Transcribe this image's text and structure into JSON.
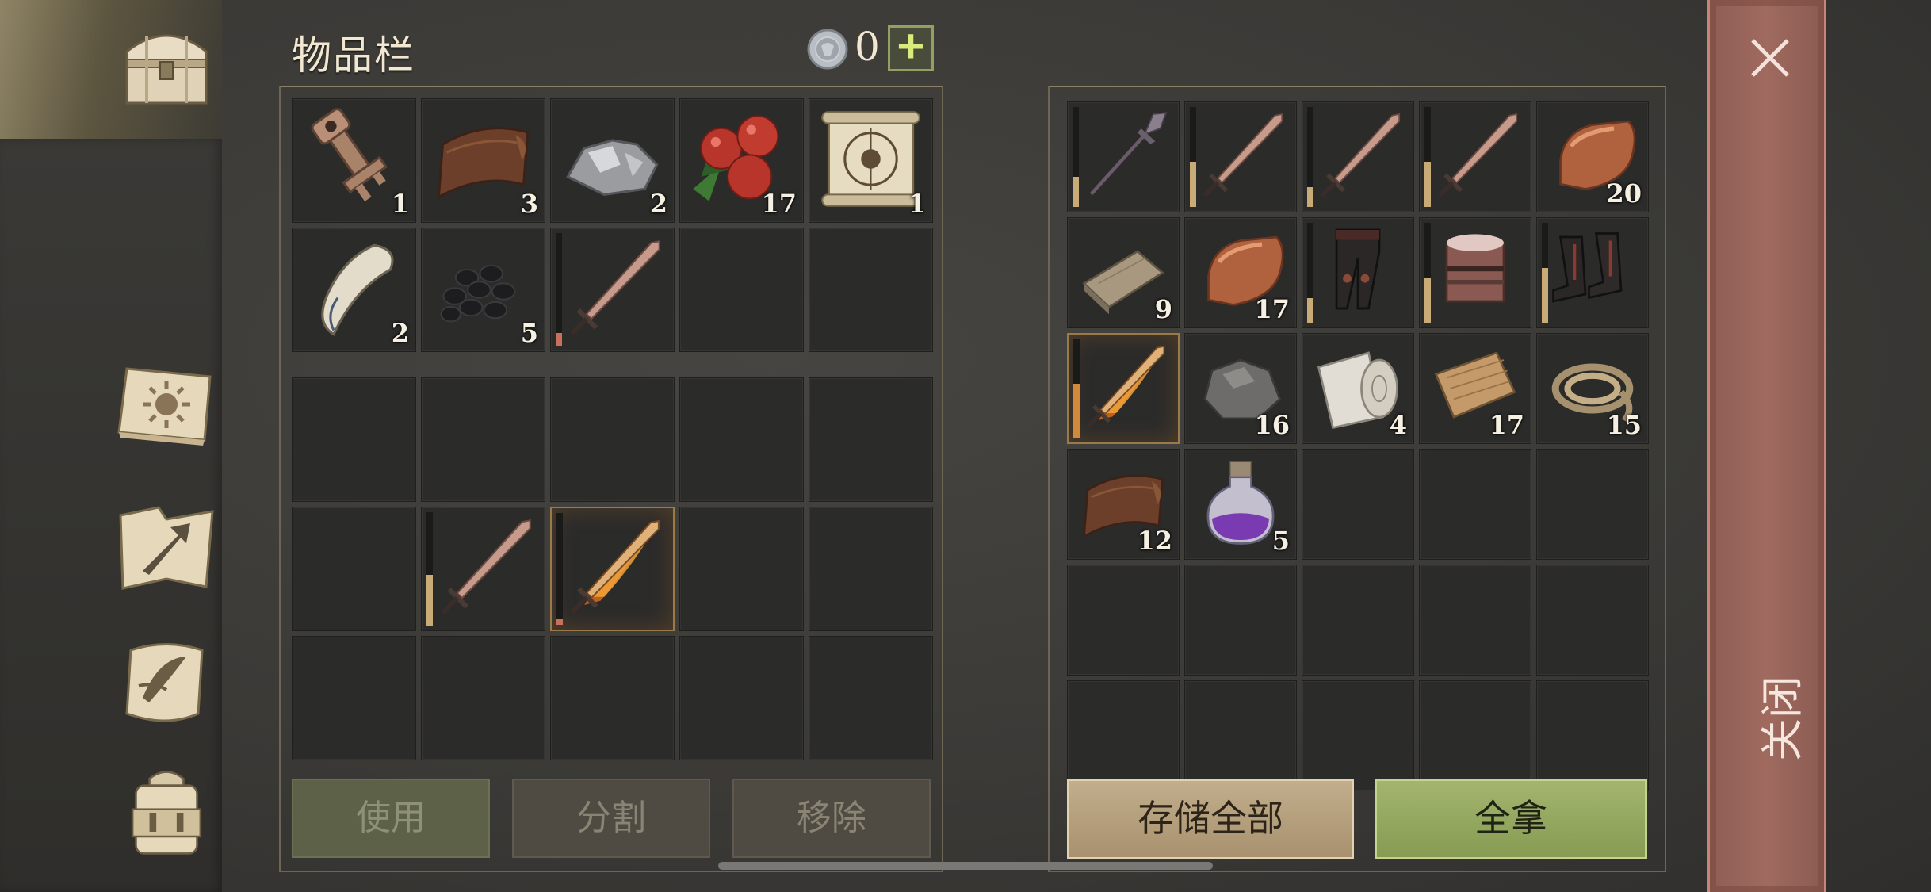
{
  "inventory": {
    "title": "物品栏",
    "currency_value": "0",
    "add_label": "+",
    "top_slots": [
      {
        "item": "key-icon",
        "qty": "1"
      },
      {
        "item": "leather-icon",
        "qty": "3"
      },
      {
        "item": "silver-ore-icon",
        "qty": "2"
      },
      {
        "item": "berries-icon",
        "qty": "17"
      },
      {
        "item": "scroll-map-icon",
        "qty": "1"
      },
      {
        "item": "fang-icon",
        "qty": "2"
      },
      {
        "item": "coal-icon",
        "qty": "5"
      },
      {
        "item": "sword-icon",
        "qty": "",
        "durability": 0.12,
        "durability_color": "#c8705a"
      },
      {
        "item": "",
        "qty": ""
      },
      {
        "item": "",
        "qty": ""
      }
    ],
    "bottom_slots": [
      {
        "item": "",
        "qty": ""
      },
      {
        "item": "",
        "qty": ""
      },
      {
        "item": "",
        "qty": ""
      },
      {
        "item": "",
        "qty": ""
      },
      {
        "item": "",
        "qty": ""
      },
      {
        "item": "",
        "qty": ""
      },
      {
        "item": "sword-icon",
        "qty": "",
        "durability": 0.45,
        "durability_color": "#c9ab78"
      },
      {
        "item": "flame-sword-icon",
        "qty": "",
        "durability": 0.05,
        "durability_color": "#c8705a",
        "selected": true
      },
      {
        "item": "",
        "qty": ""
      },
      {
        "item": "",
        "qty": ""
      },
      {
        "item": "",
        "qty": ""
      },
      {
        "item": "",
        "qty": ""
      },
      {
        "item": "",
        "qty": ""
      },
      {
        "item": "",
        "qty": ""
      },
      {
        "item": "",
        "qty": ""
      }
    ],
    "buttons": {
      "use": "使用",
      "split": "分割",
      "remove": "移除"
    }
  },
  "storage": {
    "slots": [
      {
        "item": "spear-icon",
        "qty": "",
        "durability": 0.3,
        "durability_color": "#c9ab78"
      },
      {
        "item": "sword-icon",
        "qty": "",
        "durability": 0.45,
        "durability_color": "#c9ab78"
      },
      {
        "item": "sword-icon",
        "qty": "",
        "durability": 0.2,
        "durability_color": "#c9ab78"
      },
      {
        "item": "sword-icon",
        "qty": "",
        "durability": 0.45,
        "durability_color": "#c9ab78"
      },
      {
        "item": "copper-ingot-icon",
        "qty": "20"
      },
      {
        "item": "plank-icon",
        "qty": "9"
      },
      {
        "item": "copper-ingot-icon",
        "qty": "17"
      },
      {
        "item": "leg-armor-icon",
        "qty": "",
        "durability": 0.25,
        "durability_color": "#c9ab78"
      },
      {
        "item": "helmet-icon",
        "qty": "",
        "durability": 0.45,
        "durability_color": "#c9ab78"
      },
      {
        "item": "boots-icon",
        "qty": "",
        "durability": 0.55,
        "durability_color": "#c9ab78"
      },
      {
        "item": "flame-sword-icon",
        "qty": "",
        "durability": 0.55,
        "durability_color": "#d08a3a",
        "selected": true
      },
      {
        "item": "stone-icon",
        "qty": "16"
      },
      {
        "item": "cloth-roll-icon",
        "qty": "4"
      },
      {
        "item": "burlap-icon",
        "qty": "17"
      },
      {
        "item": "rope-icon",
        "qty": "15"
      },
      {
        "item": "leather-icon",
        "qty": "12"
      },
      {
        "item": "potion-icon",
        "qty": "5"
      },
      {
        "item": "",
        "qty": ""
      },
      {
        "item": "",
        "qty": ""
      },
      {
        "item": "",
        "qty": ""
      },
      {
        "item": "",
        "qty": ""
      },
      {
        "item": "",
        "qty": ""
      },
      {
        "item": "",
        "qty": ""
      },
      {
        "item": "",
        "qty": ""
      },
      {
        "item": "",
        "qty": ""
      },
      {
        "item": "",
        "qty": ""
      },
      {
        "item": "",
        "qty": ""
      },
      {
        "item": "",
        "qty": ""
      },
      {
        "item": "",
        "qty": ""
      },
      {
        "item": "",
        "qty": ""
      }
    ],
    "buttons": {
      "store_all": "存储全部",
      "take_all": "全拿"
    }
  },
  "sidebar": {
    "items": [
      "chest-icon",
      "journal-icon",
      "crafting-icon",
      "quest-scroll-icon",
      "backpack-icon"
    ]
  },
  "close": {
    "label": "关闭"
  }
}
